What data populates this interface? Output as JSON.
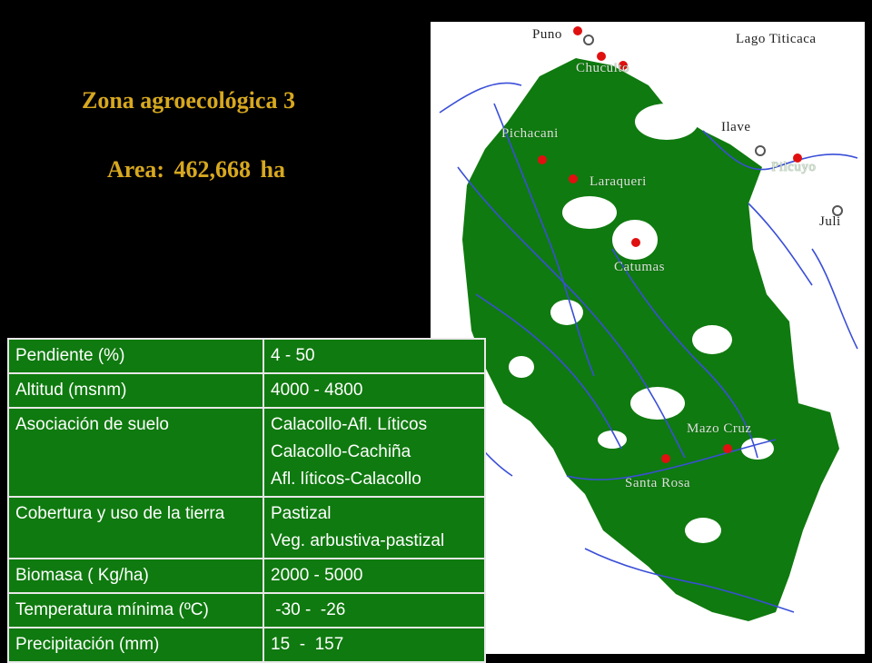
{
  "title": "Zona agroecológica 3",
  "area": "Area:  462,668 ha",
  "map": {
    "places": {
      "puno": "Puno",
      "chucuito": "Chucuito",
      "lago": "Lago  Titicaca",
      "ilave": "Ilave",
      "pichacani": "Pichacani",
      "laraqueri": "Laraqueri",
      "pilcuyo": "Pilcuyo",
      "juli": "Juli",
      "catumas": "Catumas",
      "mazocruz": "Mazo Cruz",
      "santarosa": "Santa Rosa"
    },
    "colors": {
      "vegetation": "#0f7a0f",
      "rivers": "#3a4fd8",
      "markers": "#e01010"
    }
  },
  "table": {
    "rows": [
      {
        "key": "Pendiente (%)",
        "values": [
          "4 - 50"
        ]
      },
      {
        "key": "Altitud (msnm)",
        "values": [
          "4000 - 4800"
        ]
      },
      {
        "key": "Asociación de suelo",
        "values": [
          "Calacollo-Afl. Líticos",
          "Calacollo-Cachiña",
          "Afl. líticos-Calacollo"
        ]
      },
      {
        "key": "Cobertura y uso  de la tierra",
        "values": [
          "Pastizal",
          "Veg. arbustiva-pastizal"
        ]
      },
      {
        "key": "Biomasa ( Kg/ha)",
        "values": [
          "2000 - 5000"
        ]
      },
      {
        "key": "Temperatura mínima (ºC)",
        "values": [
          " -30 -  -26"
        ]
      },
      {
        "key": "Precipitación (mm)",
        "values": [
          "15  -  157"
        ]
      }
    ]
  }
}
